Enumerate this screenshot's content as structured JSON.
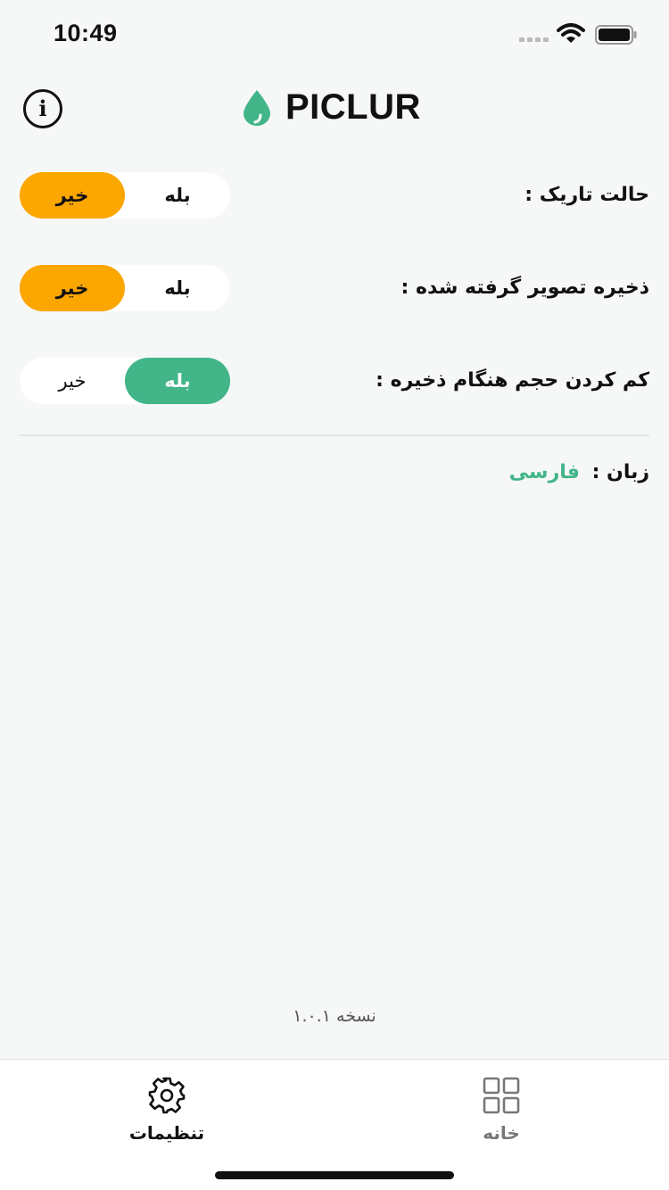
{
  "status_bar": {
    "time": "10:49",
    "icons": [
      "signal-icon",
      "wifi-icon",
      "battery-icon"
    ]
  },
  "header": {
    "app_name": "PICLUR",
    "info_icon": "info-icon",
    "logo_icon": "water-drop-icon"
  },
  "colors": {
    "accent_green": "#42b589",
    "accent_orange": "#fca600",
    "background": "#f6f7f7"
  },
  "settings": {
    "dark_mode": {
      "label": "حالت تاریک :",
      "yes": "بله",
      "no": "خیر",
      "selected": "no"
    },
    "save_processed_image": {
      "label": "ذخیره تصویر گرفته شده :",
      "yes": "بله",
      "no": "خیر",
      "selected": "no"
    },
    "reduce_size_on_save": {
      "label": "کم کردن حجم هنگام ذخیره :",
      "yes": "بله",
      "no": "خیر",
      "selected": "yes"
    }
  },
  "language": {
    "label": "زبان :",
    "value": "فارسی"
  },
  "version": "نسخه ۱.۰.۱",
  "tab_bar": {
    "tabs": [
      {
        "label": "تنظیمات",
        "icon": "gear-icon",
        "active": true
      },
      {
        "label": "خانه",
        "icon": "grid-icon",
        "active": false
      }
    ]
  }
}
